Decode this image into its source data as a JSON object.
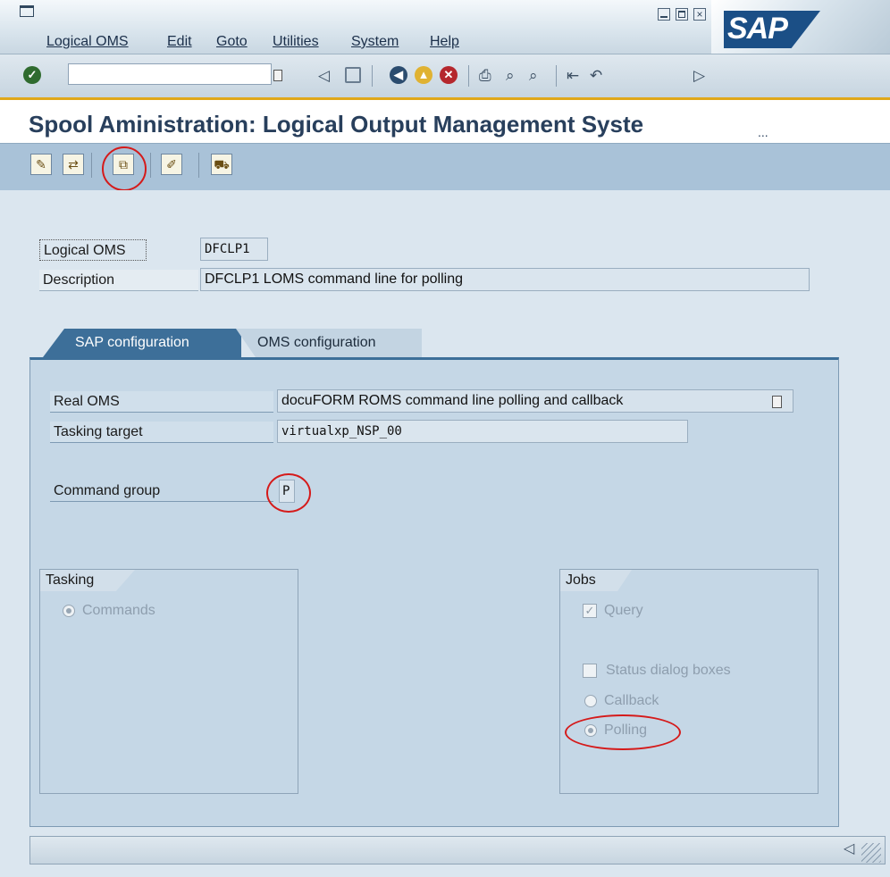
{
  "menubar": {
    "items": [
      "Logical OMS",
      "Edit",
      "Goto",
      "Utilities",
      "System",
      "Help"
    ],
    "logo_text": "SAP"
  },
  "toolbar": {
    "command_value": "",
    "icons": [
      "enter-icon",
      "command-dropdown-icon",
      "back-arrow-icon",
      "save-icon",
      "back-icon",
      "exit-icon",
      "cancel-icon",
      "print-icon",
      "find-icon",
      "find-next-icon",
      "first-page-icon",
      "previous-page-icon",
      "next-page-icon",
      "last-page-icon",
      "create-session-icon",
      "help-icon"
    ]
  },
  "title": {
    "text": "Spool Aministration: Logical Output Management Syste",
    "ellipsis": "..."
  },
  "app_toolbar": {
    "icons": [
      "change-icon",
      "other-object-icon",
      "copy-icon",
      "edit-icon",
      "transport-icon"
    ]
  },
  "header_fields": {
    "logical_oms_label": "Logical OMS",
    "logical_oms_value": "DFCLP1",
    "description_label": "Description",
    "description_value": "DFCLP1 LOMS command line for polling"
  },
  "tabs": [
    {
      "label": "SAP configuration",
      "active": true
    },
    {
      "label": "OMS configuration",
      "active": false
    }
  ],
  "sap_config": {
    "real_oms_label": "Real OMS",
    "real_oms_value": "docuFORM ROMS command line polling and callback",
    "tasking_target_label": "Tasking target",
    "tasking_target_value": "virtualxp_NSP_00",
    "command_group_label": "Command group",
    "command_group_value": "P"
  },
  "tasking_group": {
    "title": "Tasking",
    "options": [
      {
        "label": "Commands",
        "selected": true
      }
    ]
  },
  "jobs_group": {
    "title": "Jobs",
    "query_label": "Query",
    "query_checked": true,
    "status_dialog_label": "Status dialog boxes",
    "status_dialog_checked": false,
    "callback_label": "Callback",
    "callback_selected": false,
    "polling_label": "Polling",
    "polling_selected": true
  },
  "colors": {
    "title_text": "#283f5c",
    "active_tab": "#3d6f99",
    "highlight_ellipse": "#d51a1a",
    "toolbar_accent": "#e0a81a"
  }
}
